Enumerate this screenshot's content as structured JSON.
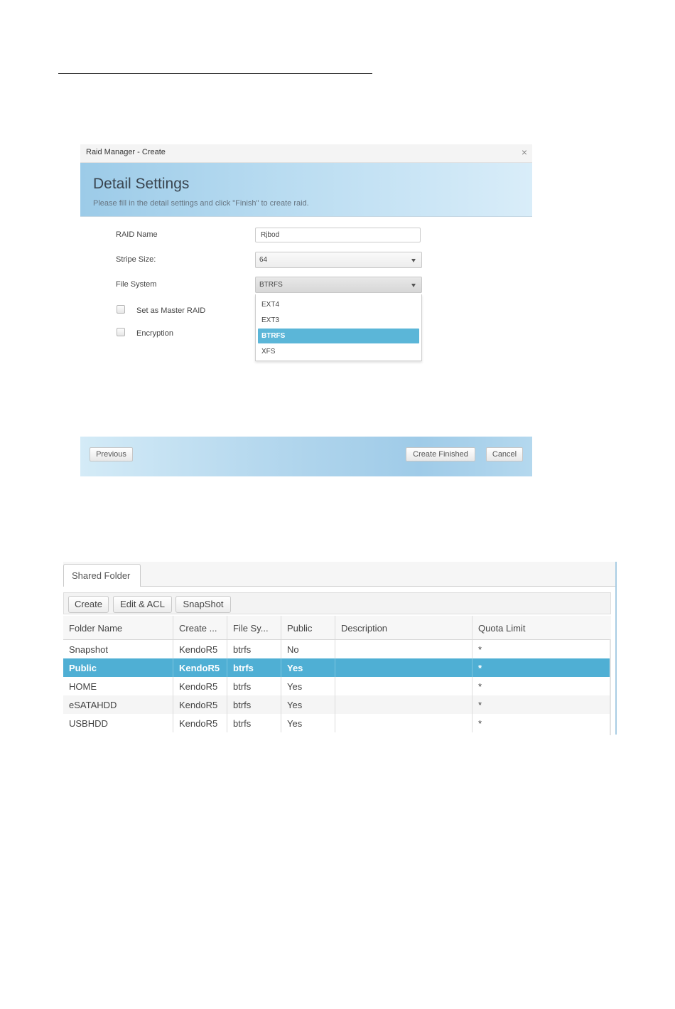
{
  "raid_dialog": {
    "window_title": "Raid Manager - Create",
    "close_glyph": "×",
    "heading": "Detail Settings",
    "subtitle": "Please fill in the detail settings and click \"Finish\" to create raid.",
    "fields": {
      "raid_name_label": "RAID Name",
      "raid_name_value": "Rjbod",
      "stripe_size_label": "Stripe Size:",
      "stripe_size_value": "64",
      "file_system_label": "File System",
      "file_system_value": "BTRFS",
      "file_system_options": [
        "EXT4",
        "EXT3",
        "BTRFS",
        "XFS"
      ],
      "file_system_selected_option": "BTRFS",
      "master_raid_label": "Set as Master RAID",
      "master_raid_checked": false,
      "encryption_label": "Encryption",
      "encryption_checked": false
    },
    "footer": {
      "previous_label": "Previous",
      "create_finished_label": "Create Finished",
      "cancel_label": "Cancel"
    }
  },
  "shared_folder": {
    "tab_label": "Shared Folder",
    "toolbar": {
      "create_label": "Create",
      "edit_acl_label": "Edit & ACL",
      "snapshot_label": "SnapShot"
    },
    "columns": [
      "Folder Name",
      "Create ...",
      "File Sy...",
      "Public",
      "Description",
      "Quota Limit"
    ],
    "rows": [
      [
        "Snapshot",
        "KendoR5",
        "btrfs",
        "No",
        "",
        "*"
      ],
      [
        "Public",
        "KendoR5",
        "btrfs",
        "Yes",
        "",
        "*"
      ],
      [
        "HOME",
        "KendoR5",
        "btrfs",
        "Yes",
        "",
        "*"
      ],
      [
        "eSATAHDD",
        "KendoR5",
        "btrfs",
        "Yes",
        "",
        "*"
      ],
      [
        "USBHDD",
        "KendoR5",
        "btrfs",
        "Yes",
        "",
        "*"
      ]
    ],
    "selected_row": "Public"
  },
  "colors": {
    "selection_blue": "#4fafd4",
    "header_gradient_start": "#9ccbe8",
    "header_gradient_end": "#d9edf9"
  }
}
